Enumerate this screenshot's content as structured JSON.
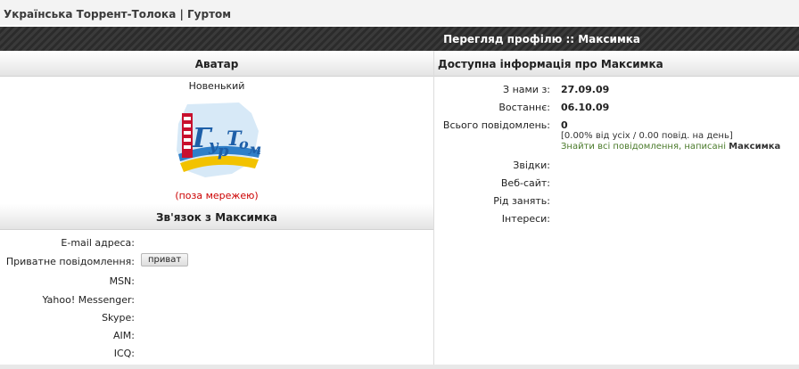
{
  "breadcrumb": {
    "site_title": "Українська Торрент-Толока | Гуртом"
  },
  "header": {
    "title": "Перегляд профілю :: Максимка"
  },
  "avatar_section": {
    "heading": "Аватар",
    "rank": "Новенький",
    "logo_text": "ГуРТоМ",
    "status": "(поза мережею)"
  },
  "contact_section": {
    "heading": "Зв'язок з Максимка",
    "rows": [
      {
        "label": "E-mail адреса:",
        "value": ""
      },
      {
        "label": "Приватне повідомлення:",
        "button": "приват"
      },
      {
        "label": "MSN:",
        "value": ""
      },
      {
        "label": "Yahoo! Messenger:",
        "value": ""
      },
      {
        "label": "Skype:",
        "value": ""
      },
      {
        "label": "AIM:",
        "value": ""
      },
      {
        "label": "ICQ:",
        "value": ""
      }
    ]
  },
  "info_section": {
    "heading": "Доступна інформація про Максимка",
    "joined_label": "З нами з:",
    "joined_value": "27.09.09",
    "last_label": "Востаннє:",
    "last_value": "06.10.09",
    "posts_label": "Всього повідомлень:",
    "posts_value": "0",
    "posts_stats": "[0.00% від усіх / 0.00 повід. на день]",
    "find_posts_text": "Знайти всі повідомлення, написані",
    "find_posts_user": "Максимка",
    "from_label": "Звідки:",
    "website_label": "Веб-сайт:",
    "occupation_label": "Рід занять:",
    "interests_label": "Інтереси:"
  },
  "colors": {
    "title_bar": "#333333",
    "offline": "#cc0000",
    "link_green": "#4a7a2a"
  }
}
